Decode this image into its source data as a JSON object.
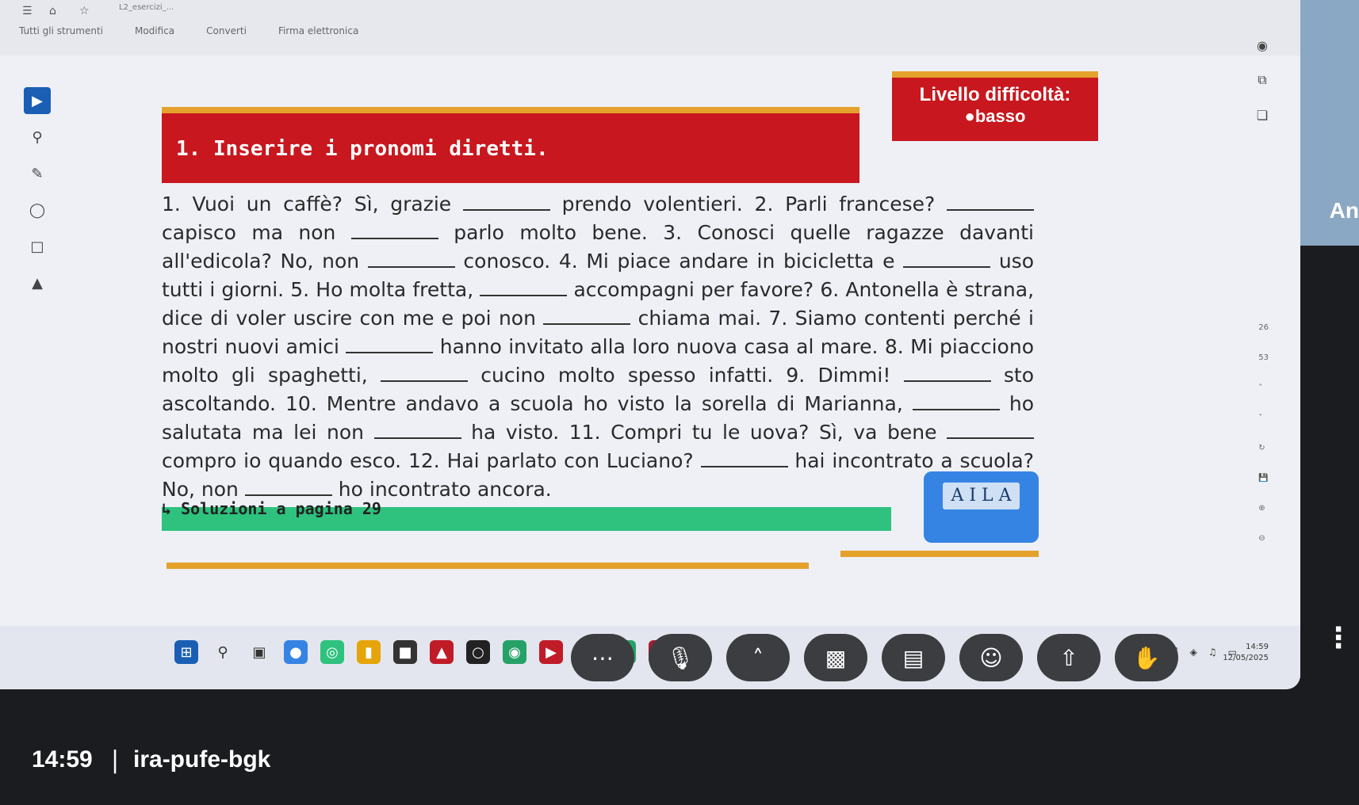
{
  "viewer": {
    "doc_title": "L2_esercizi_...",
    "menu": [
      "Tutti gli strumenti",
      "Modifica",
      "Converti",
      "Firma elettronica"
    ]
  },
  "page": {
    "title": "1. Inserire i pronomi diretti.",
    "level_label": "Livello difficoltà:",
    "level_value": "basso",
    "exercise": {
      "p1a": "1. Vuoi un caffè? Sì, grazie",
      "p1b": "prendo volentieri.",
      "p2a": "2. Parli francese?",
      "p2b": "capisco ma non",
      "p2c": "parlo molto bene.",
      "p3a": "3. Conosci quelle ragazze davanti all'edicola? No, non",
      "p3b": "conosco.",
      "p4a": "4. Mi piace andare in bicicletta e",
      "p4b": "uso tutti i giorni.",
      "p5a": "5. Ho molta fretta,",
      "p5b": "accompagni per favore?",
      "p6a": "6. Antonella è strana, dice di voler uscire con me e poi non",
      "p6b": "chiama mai.",
      "p7a": "7. Siamo contenti perché i nostri nuovi amici",
      "p7b": "hanno invitato alla loro nuova casa al mare.",
      "p8a": "8. Mi piacciono molto gli spaghetti,",
      "p8b": "cucino molto spesso infatti.",
      "p9a": "9. Dimmi!",
      "p9b": "sto ascoltando.",
      "p10a": "10. Mentre andavo a scuola ho visto la sorella di Marianna,",
      "p10b": "ho salutata ma lei non",
      "p10c": "ha visto.",
      "p11a": "11. Compri tu le uova? Sì, va bene",
      "p11b": "compro io quando esco.",
      "p12a": "12. Hai parlato con Luciano?",
      "p12b": "hai incontrato a scuola? No, non",
      "p12c": "ho incontrato ancora."
    },
    "solutions": "Soluzioni a pagina 29",
    "logo_text": "A I L A"
  },
  "right_rail": {
    "page_numbers": [
      "26",
      "53"
    ]
  },
  "taskbar": {
    "time": "14:59",
    "date": "12/05/2025"
  },
  "meeting": {
    "time": "14:59",
    "separator": "|",
    "code": "ira-pufe-bgk",
    "participant": "An"
  }
}
